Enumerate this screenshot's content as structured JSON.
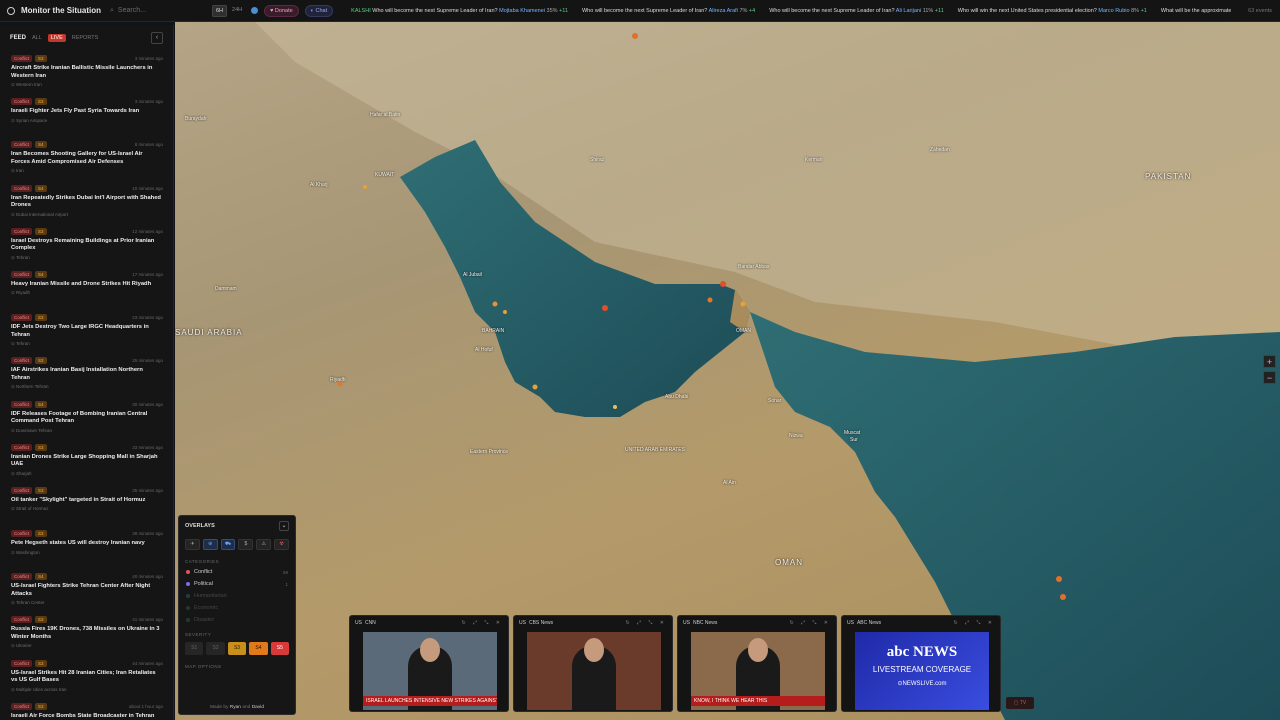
{
  "app": {
    "title": "Monitor the Situation",
    "search_placeholder": "Search...",
    "time_ranges": [
      "6H",
      "24H"
    ],
    "donate": "Donate",
    "chat": "Chat",
    "events_count": "63 events"
  },
  "ticker": [
    {
      "source": "KALSHI",
      "q": "Who will become the next Supreme Leader of Iran?",
      "who": "Mojtaba Khamenei",
      "pct": "35%",
      "chg": "+11"
    },
    {
      "source": "",
      "q": "Who will become the next Supreme Leader of Iran?",
      "who": "Alireza Arafi",
      "pct": "7%",
      "chg": "+4"
    },
    {
      "source": "",
      "q": "Who will become the next Supreme Leader of Iran?",
      "who": "Ali Larijani",
      "pct": "11%",
      "chg": "+11"
    },
    {
      "source": "",
      "q": "Who will win the next United States presidential election?",
      "who": "Marco Rubio",
      "pct": "8%",
      "chg": "+1"
    },
    {
      "source": "",
      "q": "What will be the approximate number of",
      "who": "",
      "pct": "",
      "chg": ""
    }
  ],
  "feed": {
    "title": "FEED",
    "tabs": [
      "ALL",
      "LIVE",
      "REPORTS"
    ],
    "items": [
      {
        "cat": "Conflict",
        "sev": "S3",
        "time": "3 minutes ago",
        "title": "Aircraft Strike Iranian Ballistic Missile Launchers in Western Iran",
        "loc": "Western Iran"
      },
      {
        "cat": "Conflict",
        "sev": "S3",
        "time": "3 minutes ago",
        "title": "Israeli Fighter Jets Fly Past Syria Towards Iran",
        "loc": "Syrian Airspace"
      },
      {
        "cat": "Conflict",
        "sev": "S4",
        "time": "8 minutes ago",
        "title": "Iran Becomes Shooting Gallery for US-Israel Air Forces Amid Compromised Air Defenses",
        "loc": "Iran"
      },
      {
        "cat": "Conflict",
        "sev": "S4",
        "time": "10 minutes ago",
        "title": "Iran Repeatedly Strikes Dubai Int'l Airport with Shahed Drones",
        "loc": "Dubai International Airport"
      },
      {
        "cat": "Conflict",
        "sev": "S3",
        "time": "12 minutes ago",
        "title": "Israel Destroys Remaining Buildings at Prior Iranian Complex",
        "loc": "Tehran"
      },
      {
        "cat": "Conflict",
        "sev": "S4",
        "time": "17 minutes ago",
        "title": "Heavy Iranian Missile and Drone Strikes Hit Riyadh",
        "loc": "Riyadh"
      },
      {
        "cat": "Conflict",
        "sev": "S3",
        "time": "23 minutes ago",
        "title": "IDF Jets Destroy Two Large IRGC Headquarters in Tehran",
        "loc": "Tehran"
      },
      {
        "cat": "Conflict",
        "sev": "S3",
        "time": "25 minutes ago",
        "title": "IAF Airstrikes Iranian Basij Installation Northern Tehran",
        "loc": "Northern Tehran"
      },
      {
        "cat": "Conflict",
        "sev": "S4",
        "time": "30 minutes ago",
        "title": "IDF Releases Footage of Bombing Iranian Central Command Post Tehran",
        "loc": "Downtown Tehran"
      },
      {
        "cat": "Conflict",
        "sev": "S3",
        "time": "33 minutes ago",
        "title": "Iranian Drones Strike Large Shopping Mall in Sharjah UAE",
        "loc": "Sharjah"
      },
      {
        "cat": "Conflict",
        "sev": "S3",
        "time": "35 minutes ago",
        "title": "Oil tanker \"Skylight\" targeted in Strait of Hormuz",
        "loc": "Strait of Hormuz"
      },
      {
        "cat": "Conflict",
        "sev": "S3",
        "time": "38 minutes ago",
        "title": "Pete Hegseth states US will destroy Iranian navy",
        "loc": "Washington"
      },
      {
        "cat": "Conflict",
        "sev": "S4",
        "time": "40 minutes ago",
        "title": "US-Israel Fighters Strike Tehran Center After Night Attacks",
        "loc": "Tehran Center"
      },
      {
        "cat": "Conflict",
        "sev": "S3",
        "time": "41 minutes ago",
        "title": "Russia Fires 19K Drones, 738 Missiles on Ukraine in 3 Winter Months",
        "loc": "Ukraine"
      },
      {
        "cat": "Conflict",
        "sev": "S3",
        "time": "44 minutes ago",
        "title": "US-Israel Strikes Hit 28 Iranian Cities; Iran Retaliates vs US Gulf Bases",
        "loc": "Multiple cities across Iran"
      },
      {
        "cat": "Conflict",
        "sev": "S3",
        "time": "about 1 hour ago",
        "title": "Israeli Air Force Bombs State Broadcaster in Tehran",
        "loc": ""
      }
    ]
  },
  "map_labels": [
    {
      "text": "SAUDI ARABIA",
      "cls": "big"
    },
    {
      "text": "BAHRAIN",
      "cls": ""
    },
    {
      "text": "OMAN",
      "cls": ""
    },
    {
      "text": "KUWAIT",
      "cls": ""
    },
    {
      "text": "UNITED ARAB EMIRATES",
      "cls": ""
    },
    {
      "text": "OMAN",
      "cls": "big"
    },
    {
      "text": "PAKISTAN",
      "cls": "big"
    },
    {
      "text": "Abu Dhabi",
      "cls": ""
    },
    {
      "text": "Muscat",
      "cls": ""
    },
    {
      "text": "Bandar Abbas",
      "cls": ""
    },
    {
      "text": "Al Jubail",
      "cls": ""
    },
    {
      "text": "Dammam",
      "cls": ""
    },
    {
      "text": "Buraydah",
      "cls": ""
    },
    {
      "text": "Riyadh",
      "cls": ""
    },
    {
      "text": "Al Kharj",
      "cls": ""
    },
    {
      "text": "Hafar al Batin",
      "cls": ""
    },
    {
      "text": "Eastern Province",
      "cls": ""
    },
    {
      "text": "Al Hofuf",
      "cls": ""
    },
    {
      "text": "Sohar",
      "cls": ""
    },
    {
      "text": "Shiraz",
      "cls": ""
    },
    {
      "text": "Kerman",
      "cls": ""
    },
    {
      "text": "Zahedan",
      "cls": ""
    },
    {
      "text": "Al Ain",
      "cls": ""
    },
    {
      "text": "Nizwa",
      "cls": ""
    },
    {
      "text": "Sur",
      "cls": ""
    }
  ],
  "overlays": {
    "title": "OVERLAYS",
    "layers": [
      "✈",
      "⊕",
      "⛟",
      "$",
      "⚠",
      "☢"
    ],
    "categories_label": "CATEGORIES",
    "categories": [
      {
        "name": "Conflict",
        "color": "#e05555",
        "count": "59",
        "dim": false
      },
      {
        "name": "Political",
        "color": "#7b6ee8",
        "count": "1",
        "dim": false
      },
      {
        "name": "Humanitarian",
        "color": "#3fb8a8",
        "count": "",
        "dim": true
      },
      {
        "name": "Economic",
        "color": "#3fa85a",
        "count": "",
        "dim": true
      },
      {
        "name": "Disaster",
        "color": "#3fa85a",
        "count": "",
        "dim": true
      }
    ],
    "severity_label": "SEVERITY",
    "severity": [
      {
        "label": "S1",
        "bg": "#262626",
        "fg": "#666"
      },
      {
        "label": "S2",
        "bg": "#262626",
        "fg": "#666"
      },
      {
        "label": "S3",
        "bg": "#c8901a",
        "fg": "#2a1a00"
      },
      {
        "label": "S4",
        "bg": "#e07a1a",
        "fg": "#2a1000"
      },
      {
        "label": "S5",
        "bg": "#d83a3a",
        "fg": "#fff"
      }
    ],
    "map_options": "MAP OPTIONS",
    "credit_pre": "Made by",
    "credit_a": "Ryan",
    "credit_and": "and",
    "credit_b": "David"
  },
  "videos": [
    {
      "country": "US",
      "channel": "CNN",
      "ticker": "ISRAEL LAUNCHES INTENSIVE NEW STRIKES AGAINST IRAN",
      "bg": "#5b6a78"
    },
    {
      "country": "US",
      "channel": "CBS News",
      "ticker": "",
      "bg": "#6a3b2a"
    },
    {
      "country": "US",
      "channel": "NBC News",
      "ticker": "KNOW, I THINK WE HEAR THIS",
      "bg": "#8a6a4a"
    },
    {
      "country": "US",
      "channel": "ABC News",
      "ticker": "",
      "bg": "#2a3acb",
      "abc_logo": "abc NEWS",
      "abc_live": "LIVESTREAM COVERAGE",
      "abc_site": "⊙NEWSLIVE.com"
    }
  ],
  "tv_label": "TV"
}
